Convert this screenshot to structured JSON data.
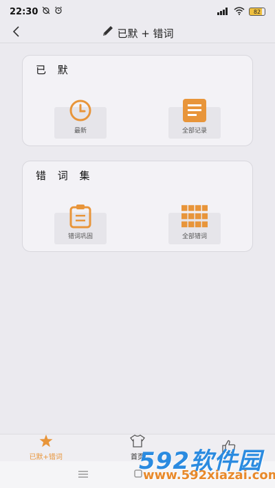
{
  "status_bar": {
    "time": "22:30",
    "battery": "82",
    "icons": [
      "alarm-off-icon",
      "alarm-icon",
      "signal-icon",
      "wifi-icon",
      "battery-icon"
    ]
  },
  "header": {
    "title": "已默 + 错词",
    "icon": "pencil-icon",
    "back_icon": "chevron-left-icon"
  },
  "sections": [
    {
      "title": "已 默",
      "items": [
        {
          "label": "最新",
          "icon": "clock-icon"
        },
        {
          "label": "全部记录",
          "icon": "document-icon"
        }
      ]
    },
    {
      "title": "错 词 集",
      "items": [
        {
          "label": "错词巩固",
          "icon": "clipboard-icon"
        },
        {
          "label": "全部错词",
          "icon": "grid-icon"
        }
      ]
    }
  ],
  "bottom_nav": {
    "items": [
      {
        "label": "已默+错词",
        "icon": "star-icon",
        "active": true
      },
      {
        "label": "首页",
        "icon": "shirt-icon",
        "active": false
      },
      {
        "label": "",
        "icon": "thumbs-up-icon",
        "active": false
      }
    ]
  },
  "watermark": {
    "logo": "592软件园",
    "url": "www.592xiazai.com"
  },
  "colors": {
    "accent": "#e8953a",
    "background": "#ebeaef",
    "card": "#f3f2f6",
    "watermark_blue": "#2b8be0",
    "watermark_orange": "#e8892a"
  }
}
